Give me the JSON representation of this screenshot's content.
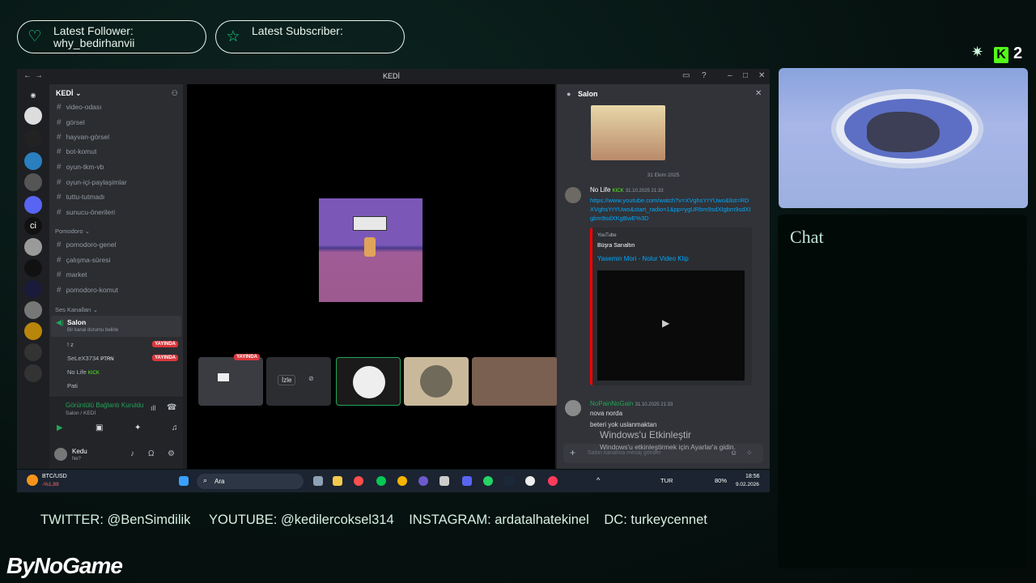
{
  "overlay": {
    "follower_label": "Latest Follower:",
    "follower_name": "why_bedirhanvii",
    "subscriber_label": "Latest Subscriber:",
    "kick_count": "2",
    "chat_title": "Chat",
    "socials": {
      "twitter": "TWITTER: @BenSimdilik",
      "youtube": "YOUTUBE: @kedilercoksel314",
      "instagram": "INSTAGRAM: ardatalhatekinel",
      "dc": "DC: turkeycennet"
    },
    "logo": "ByNoGame"
  },
  "window": {
    "title": "KEDİ"
  },
  "server": {
    "name": "KEDİ",
    "text_channels": [
      "video-odası",
      "görsel",
      "hayvan-görsel",
      "bot-komut",
      "oyun-tkm-vb",
      "oyun-içi-paylaşimlar",
      "tuttu-tutmadı",
      "sunucu-önerileri"
    ],
    "category2": "Pomodoro",
    "pomodoro_channels": [
      "pomodoro-genel",
      "çalışma-süresi",
      "market",
      "pomodoro-komut"
    ],
    "voice_category": "Ses Kanalları",
    "voice_channel": "Salon",
    "voice_status": "Bir kanal durumu belirle",
    "voice_users": [
      {
        "name": "! z",
        "live": "YAYINDA"
      },
      {
        "name": "SeLeX3734",
        "tag": "PTRN",
        "live": "YAYINDA"
      },
      {
        "name": "No Life",
        "tag": "KICK"
      },
      {
        "name": "Pati"
      }
    ]
  },
  "voice_panel": {
    "status": "Görüntülü Bağlantı Kuruldu",
    "location": "Salon / KEDİ",
    "user": "Kedu",
    "user_status": "Ne?"
  },
  "stage": {
    "live_badge": "YAYINDA",
    "watch": "İzle"
  },
  "chat": {
    "title": "Salon",
    "date": "31 Ekim 2025",
    "msg1_author": "No Life",
    "msg1_tag": "KICK",
    "msg1_time": "31.10.2025 21:33",
    "msg1_link": "https://www.youtube.com/watch?v=XVghsYrYUwo&list=RDXVghsYrYUwo&start_radio=1&pp=ygURbm9sdXIgbm9sdXIgbm9sdXKgBwE%3D",
    "embed_provider": "YouTube",
    "embed_author": "Büşra Sarıaltın",
    "embed_title": "Yasemin Mori - Nolur Video Klip",
    "msg2_author": "NoPainNoGain",
    "msg2_time": "31.10.2025 21:33",
    "msg2_line1": "nova norda",
    "msg2_line2": "beteri yok uslanmaktan",
    "input_placeholder": "Salon kanalına mesaj gönder"
  },
  "watermark": {
    "line1": "Windows'u Etkinleştir",
    "line2": "Windows'u etkinleştirmek için Ayarlar'a gidin."
  },
  "taskbar": {
    "ticker": "BTC/USD",
    "ticker_change": "-%1,89",
    "search": "Ara",
    "lang": "TUR",
    "battery": "80%",
    "time": "18:56",
    "date": "9.02.2026"
  }
}
